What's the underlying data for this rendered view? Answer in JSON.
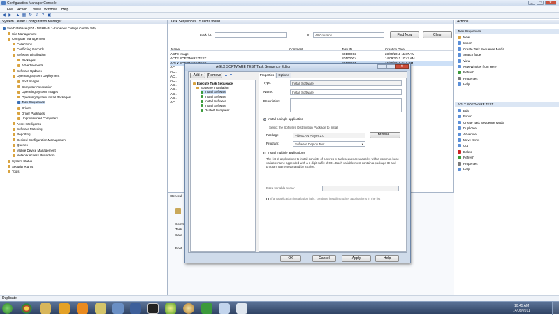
{
  "window": {
    "title": "Configuration Manager Console",
    "controls": [
      "_",
      "□",
      "✕"
    ]
  },
  "menu": [
    "File",
    "Action",
    "View",
    "Window",
    "Help"
  ],
  "tree": {
    "header": "System Center Configuration Manager",
    "items": [
      {
        "label": "Site Database (S01 - MSHB-BL1-Ironwood College Central Site)",
        "indent": 0,
        "color": "#3a6fb5"
      },
      {
        "label": "Site Management",
        "indent": 1,
        "color": "#d9a441"
      },
      {
        "label": "Computer Management",
        "indent": 1,
        "color": "#d9a441"
      },
      {
        "label": "Collections",
        "indent": 2,
        "color": "#d9a441"
      },
      {
        "label": "Conflicting Records",
        "indent": 2,
        "color": "#d9a441"
      },
      {
        "label": "Software Distribution",
        "indent": 2,
        "color": "#d9a441"
      },
      {
        "label": "Packages",
        "indent": 3,
        "color": "#d9a441"
      },
      {
        "label": "Advertisements",
        "indent": 3,
        "color": "#d9a441"
      },
      {
        "label": "Software Updates",
        "indent": 2,
        "color": "#d9a441"
      },
      {
        "label": "Operating System Deployment",
        "indent": 2,
        "color": "#d9a441"
      },
      {
        "label": "Boot Images",
        "indent": 3,
        "color": "#d9a441"
      },
      {
        "label": "Computer Association",
        "indent": 3,
        "color": "#d9a441"
      },
      {
        "label": "Operating System Images",
        "indent": 3,
        "color": "#d9a441"
      },
      {
        "label": "Operating System Install Packages",
        "indent": 3,
        "color": "#d9a441"
      },
      {
        "label": "Task Sequences",
        "indent": 3,
        "color": "#3a6fb5"
      },
      {
        "label": "Drivers",
        "indent": 3,
        "color": "#d9a441"
      },
      {
        "label": "Driver Packages",
        "indent": 3,
        "color": "#d9a441"
      },
      {
        "label": "Unprovisioned Computers",
        "indent": 3,
        "color": "#d9a441"
      },
      {
        "label": "Asset Intelligence",
        "indent": 2,
        "color": "#d9a441"
      },
      {
        "label": "Software Metering",
        "indent": 2,
        "color": "#d9a441"
      },
      {
        "label": "Reporting",
        "indent": 2,
        "color": "#d9a441"
      },
      {
        "label": "Desired Configuration Management",
        "indent": 2,
        "color": "#d9a441"
      },
      {
        "label": "Queries",
        "indent": 2,
        "color": "#d9a441"
      },
      {
        "label": "Mobile Device Management",
        "indent": 2,
        "color": "#d9a441"
      },
      {
        "label": "Network Access Protection",
        "indent": 2,
        "color": "#d9a441"
      },
      {
        "label": "System Status",
        "indent": 1,
        "color": "#d9a441"
      },
      {
        "label": "Security Rights",
        "indent": 1,
        "color": "#d9a441"
      },
      {
        "label": "Tools",
        "indent": 1,
        "color": "#d9a441"
      }
    ]
  },
  "center": {
    "header": "Task Sequences   15 items found",
    "look_for_label": "Look for:",
    "in_label": "In",
    "in_value": "All Columns",
    "find_now": "Find Now",
    "clear": "Clear",
    "columns": [
      "Name",
      "Comment",
      "Task ID",
      "Creation Date"
    ],
    "rows": [
      {
        "name": "ACTE Image",
        "comment": "",
        "id": "S01000C3",
        "date": "23/09/2011 11:37 AM"
      },
      {
        "name": "ACTE SOFTWARE TEST",
        "comment": "",
        "id": "S01000C4",
        "date": "14/09/2011 10:43 AM"
      },
      {
        "name": "AGLX SOFTWARE TEST",
        "comment": "",
        "id": "S01000C5",
        "date": "16/09/2011 2:12 PM"
      },
      {
        "name": "AC...",
        "comment": "",
        "id": "",
        "date": "...08 AM"
      },
      {
        "name": "AC...",
        "comment": "",
        "id": "",
        "date": "...25 AM"
      },
      {
        "name": "AC...",
        "comment": "",
        "id": "",
        "date": "...29 AM"
      },
      {
        "name": "AC...",
        "comment": "",
        "id": "",
        "date": "...10 AM"
      },
      {
        "name": "AC...",
        "comment": "",
        "id": "",
        "date": "...08 AM"
      },
      {
        "name": "AC...",
        "comment": "",
        "id": "",
        "date": "...12 AM"
      },
      {
        "name": "AC...",
        "comment": "",
        "id": "",
        "date": "...47 AM"
      },
      {
        "name": "AC...",
        "comment": "",
        "id": "",
        "date": "...42 PM"
      },
      {
        "name": "AC...",
        "comment": "",
        "id": "",
        "date": "...24 PM"
      }
    ],
    "detail_labels": [
      "General",
      "Comm",
      "Task",
      "Cate",
      "Boot"
    ]
  },
  "actions": {
    "header": "Actions",
    "section1": "Task Sequences",
    "items1": [
      {
        "label": "New",
        "color": "#d9a441"
      },
      {
        "label": "Import",
        "color": "#5b8fd8"
      },
      {
        "label": "Create Task Sequence Media",
        "color": "#5b8fd8"
      },
      {
        "label": "Search folder",
        "color": "#5b8fd8"
      },
      {
        "label": "View",
        "color": "#5b8fd8"
      },
      {
        "label": "New Window from Here",
        "color": "#5b8fd8"
      },
      {
        "label": "Refresh",
        "color": "#3a9a3a"
      },
      {
        "label": "Properties",
        "color": "#7a7a7a"
      },
      {
        "label": "Help",
        "color": "#5b8fd8"
      }
    ],
    "section2": "AGLX SOFTWARE TEST",
    "items2": [
      {
        "label": "Edit",
        "color": "#5b8fd8"
      },
      {
        "label": "Export",
        "color": "#5b8fd8"
      },
      {
        "label": "Create Task Sequence Media",
        "color": "#5b8fd8"
      },
      {
        "label": "Duplicate",
        "color": "#5b8fd8"
      },
      {
        "label": "Advertise",
        "color": "#5b8fd8"
      },
      {
        "label": "Move Items",
        "color": "#5b8fd8"
      },
      {
        "label": "Cut",
        "color": "#5b8fd8"
      },
      {
        "label": "Delete",
        "color": "#cc2222"
      },
      {
        "label": "Refresh",
        "color": "#3a9a3a"
      },
      {
        "label": "Properties",
        "color": "#7a7a7a"
      },
      {
        "label": "Help",
        "color": "#5b8fd8"
      }
    ]
  },
  "dialog": {
    "title": "AGLX SOFTWARE TEST Task Sequence Editor",
    "add": "Add",
    "remove": "Remove",
    "steps": {
      "root": "Execute Task Sequence",
      "group": "Software Installation",
      "items": [
        "Install Software",
        "Install Software",
        "Install Software",
        "Install Software",
        "Restart Computer"
      ]
    },
    "tabs": [
      "Properties",
      "Options"
    ],
    "type_label": "Type:",
    "type_value": "Install Software",
    "name_label": "Name:",
    "name_value": "Install Software",
    "desc_label": "Description:",
    "radio_single": "Install a single application",
    "pkg_hint": "Select the Software Distribution Package to install",
    "package_label": "Package:",
    "package_value": "VideoLAN Player 2.0",
    "browse": "Browse...",
    "program_label": "Program:",
    "program_value": "Software Deploy Test",
    "radio_multiple": "Install multiple applications",
    "multi_hint": "The list of applications to install consists of a series of task sequence variables with a common base variable name appended with a 3 digit suffix of 001. Each variable must contain a package ID and program name separated by a colon.",
    "base_var_label": "Base variable name:",
    "cont_on_fail": "If an application installation fails, continue installing other applications in the list",
    "ok": "OK",
    "cancel": "Cancel",
    "apply": "Apply",
    "help": "Help"
  },
  "status": "Duplicate",
  "clock": {
    "time": "10:45 AM",
    "date": "14/09/2011"
  }
}
